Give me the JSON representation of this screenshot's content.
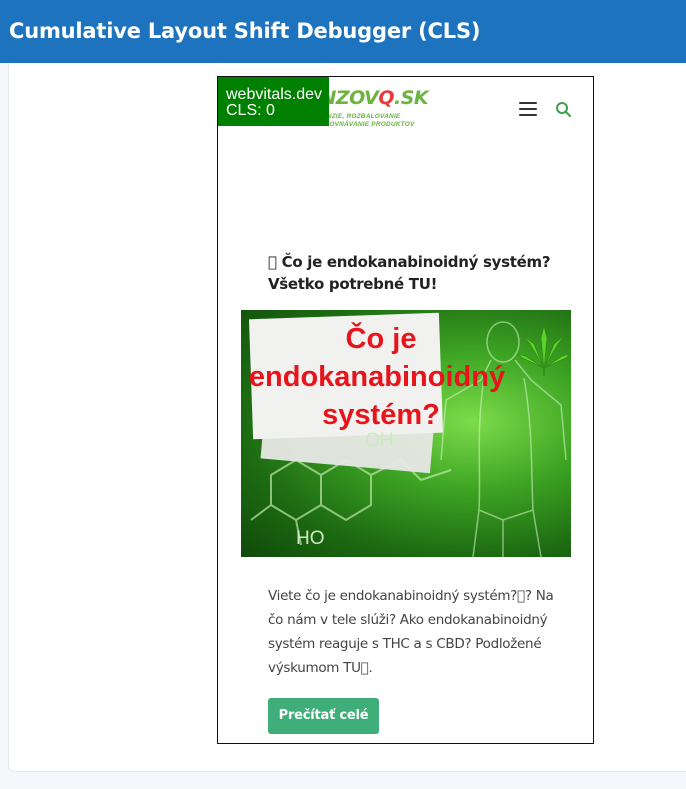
{
  "app": {
    "title": "Cumulative Layout Shift Debugger (CLS)"
  },
  "overlay": {
    "site": "webvitals.dev",
    "cls": "CLS: 0"
  },
  "site": {
    "logo_text": "ENZOVQ.SK",
    "logo_tagline_1": "RECENZIE, ROZBALOVANIE",
    "logo_tagline_2": "A POROVNÁVANIE PRODUKTOV",
    "menu_icon": "hamburger-menu-icon",
    "search_icon": "search-icon"
  },
  "post": {
    "title": "\u0000 Čo je endokanabinoidný systém? Všetko potrebné TU!",
    "image": {
      "line1": "Čo je",
      "line2": "endokanabinoidný",
      "line3": "systém?",
      "label_oh": "OH",
      "label_ho": "HO"
    },
    "excerpt": "Viete čo je endokanabinoidný systém?\u0000? Na čo nám v tele slúži? Ako endokanabinoidný systém reaguje s THC a s CBD? Podložené výskumom TU\u0000.",
    "read_more": "Prečítať celé"
  },
  "colors": {
    "header_bg": "#1e73be",
    "badge_bg": "#008000",
    "logo_green": "#6cb33f",
    "logo_red": "#e73c3c",
    "button_bg": "#3fae78",
    "headline_red": "#e8141b"
  }
}
